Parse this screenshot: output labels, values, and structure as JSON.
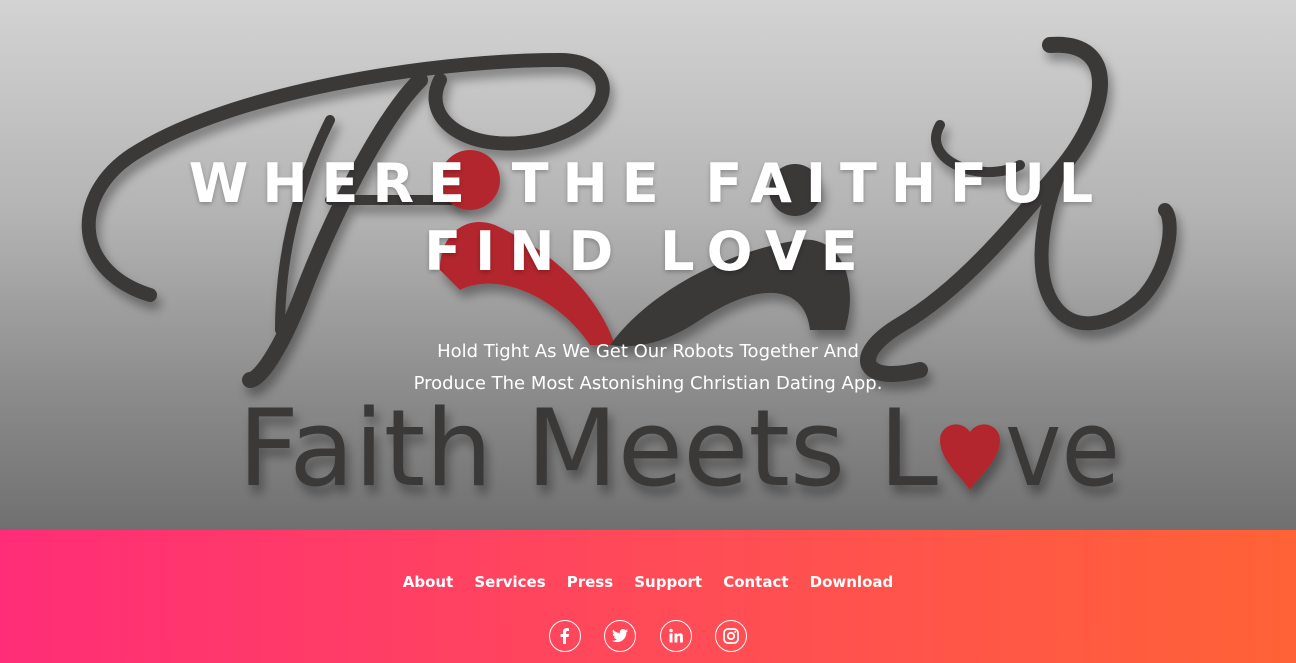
{
  "hero": {
    "headline_line1": "WHERE THE FAITHFUL",
    "headline_line2": "FIND LOVE",
    "subtitle_line1": "Hold Tight As We Get Our Robots Together And",
    "subtitle_line2": "Produce The Most Astonishing Christian Dating App.",
    "logo_wordmark_before": "Faith Meets L",
    "logo_wordmark_after": "ve"
  },
  "footer": {
    "nav": {
      "about": "About",
      "services": "Services",
      "press": "Press",
      "support": "Support",
      "contact": "Contact",
      "download": "Download"
    },
    "social_icons": [
      "facebook-icon",
      "twitter-icon",
      "linkedin-icon",
      "instagram-icon"
    ]
  },
  "colors": {
    "accent_red": "#b3272d",
    "footer_gradient_start": "#ff2d77",
    "footer_gradient_end": "#ff6236",
    "logo_dark": "#3a3939"
  }
}
